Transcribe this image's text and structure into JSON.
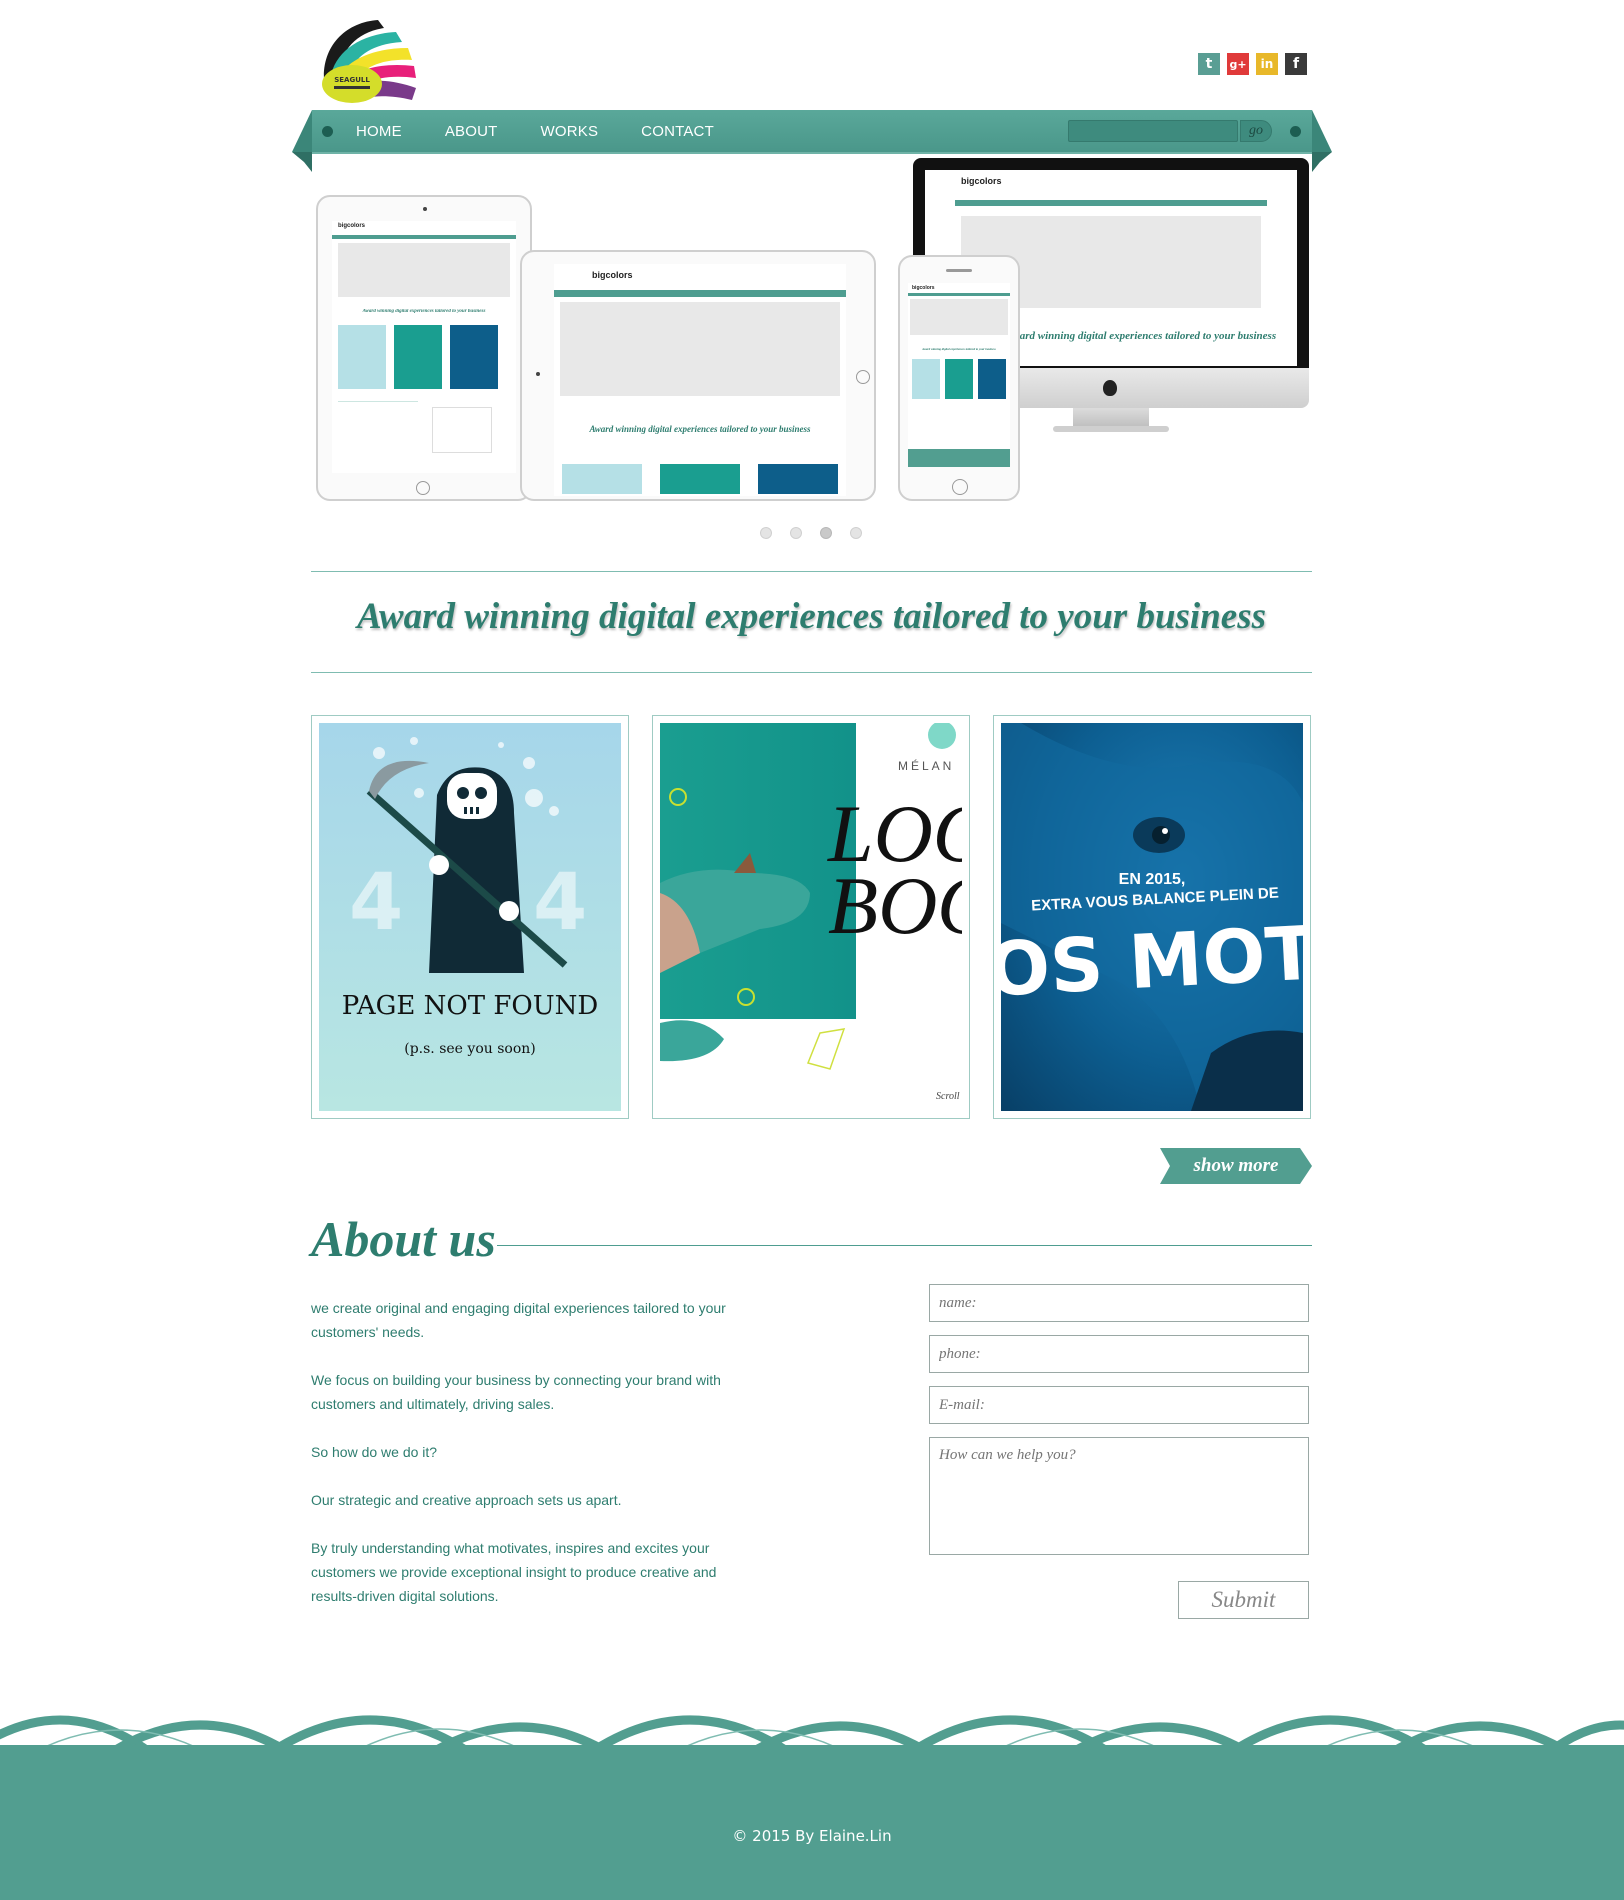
{
  "brand": {
    "logo_text": "SEAGULL",
    "colors": {
      "teal": "#529e90",
      "dark_teal": "#2e7d6f",
      "accent_black": "#1a1a1a",
      "accent_pink": "#e8207a",
      "accent_yellow": "#f0e032",
      "accent_purple": "#7a3a8a"
    }
  },
  "social": [
    {
      "name": "twitter",
      "icon": "twitter-icon",
      "glyph": "t"
    },
    {
      "name": "google-plus",
      "icon": "google-plus-icon",
      "glyph": "g+"
    },
    {
      "name": "linkedin",
      "icon": "linkedin-icon",
      "glyph": "in"
    },
    {
      "name": "facebook",
      "icon": "facebook-icon",
      "glyph": "f"
    }
  ],
  "nav": {
    "items": [
      {
        "label": "HOME"
      },
      {
        "label": "ABOUT"
      },
      {
        "label": "WORKS"
      },
      {
        "label": "CONTACT"
      }
    ],
    "search": {
      "placeholder": "",
      "button": "go"
    }
  },
  "hero": {
    "mockup_brand": "bigcolors",
    "mockup_tagline": "Award winning digital experiences tailored to your business",
    "slides": 4,
    "active_slide": 3
  },
  "tagline": "Award winning digital experiences tailored to your business",
  "works": [
    {
      "title": "PAGE NOT FOUND",
      "subtitle": "(p.s. see you soon)",
      "digits": [
        "4",
        "4"
      ]
    },
    {
      "brand": "MÉLAN",
      "big_text": [
        "LOO",
        "BOO"
      ],
      "footer": "Scroll"
    },
    {
      "lines": [
        "EN 2015,",
        "EXTRA VOUS BALANCE PLEIN DE"
      ],
      "big_text": "OS MOT"
    }
  ],
  "show_more": "show more",
  "about": {
    "title": "About us",
    "paragraphs": [
      "we create original and engaging digital experiences tailored to your customers' needs.",
      "We focus on building your business by connecting your brand with customers and ultimately, driving sales.",
      "So how do we do it?",
      "Our strategic and creative approach sets us apart.",
      "By truly understanding what motivates, inspires and excites your customers we provide exceptional insight to produce creative and results-driven digital solutions."
    ]
  },
  "form": {
    "name_placeholder": "name:",
    "phone_placeholder": "phone:",
    "email_placeholder": "E-mail:",
    "message_placeholder": "How can we help you?",
    "submit_label": "Submit"
  },
  "footer": {
    "copyright": "© 2015 By Elaine.Lin"
  }
}
